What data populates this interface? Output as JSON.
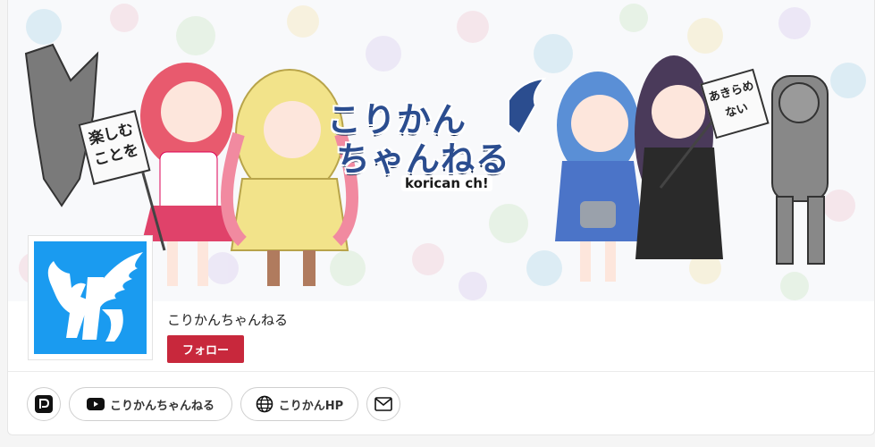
{
  "banner": {
    "title_line1": "こりかん",
    "title_line2": "ちゃんねる",
    "subtitle": "korican ch!",
    "sign_left": "楽しむことを",
    "sign_right": "あきらめない"
  },
  "profile": {
    "channel_name": "こりかんちゃんねる",
    "follow_label": "フォロー"
  },
  "links": {
    "youtube_label": "こりかんちゃんねる",
    "homepage_label": "こりかんHP"
  },
  "colors": {
    "accent": "#c8283c",
    "avatar_bg": "#1a9bf0",
    "title": "#2b4d8f"
  }
}
